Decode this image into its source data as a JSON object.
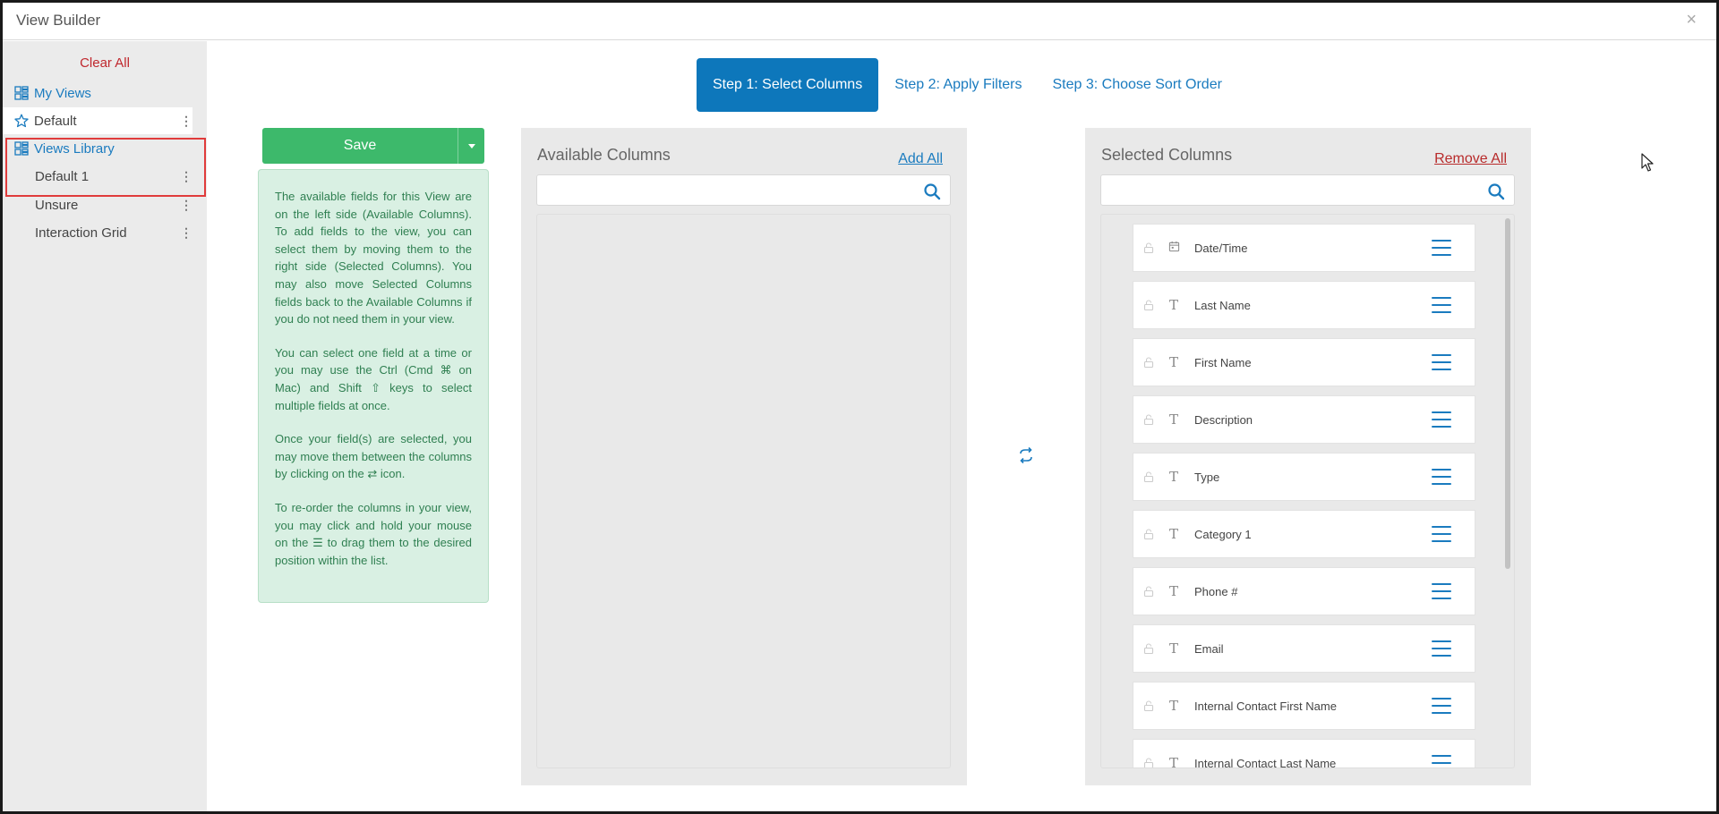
{
  "window": {
    "title": "View Builder",
    "close_glyph": "×"
  },
  "sidebar": {
    "clear_all": "Clear All",
    "my_views": {
      "label": "My Views",
      "icon": "views-grid-icon"
    },
    "default_view": {
      "label": "Default",
      "icon": "star-icon",
      "menu": "⋮"
    },
    "views_library": {
      "label": "Views Library",
      "icon": "views-grid-icon"
    },
    "library_items": [
      {
        "label": "Default 1",
        "menu": "⋮"
      },
      {
        "label": "Unsure",
        "menu": "⋮"
      },
      {
        "label": "Interaction Grid",
        "menu": "⋮"
      }
    ]
  },
  "steps": {
    "step1": "Step 1: Select Columns",
    "step2": "Step 2: Apply Filters",
    "step3": "Step 3: Choose Sort Order"
  },
  "save": {
    "label": "Save"
  },
  "help": {
    "p1": "The available fields for this View are on the left side (Available Columns). To add fields to the view, you can select them by moving them to the right side (Selected Columns). You may also move Selected Columns fields back to the Available Columns if you do not need them in your view.",
    "p2": "You can select one field at a time or you may use the Ctrl (Cmd ⌘ on Mac) and Shift ⇧ keys to select multiple fields at once.",
    "p3_before": "Once your field(s) are selected, you may move them between the columns by clicking on the ",
    "p3_icon": "⇄",
    "p3_after": " icon.",
    "p4_before": "To re-order the columns in your view, you may click and hold your mouse on the ",
    "p4_icon": "☰",
    "p4_after": " to drag them to the desired position within the list."
  },
  "available": {
    "title": "Available Columns",
    "action": "Add All",
    "search_placeholder": ""
  },
  "selected": {
    "title": "Selected Columns",
    "action": "Remove All",
    "search_placeholder": "",
    "columns": [
      {
        "name": "Date/Time",
        "type": "calendar"
      },
      {
        "name": "Last Name",
        "type": "T"
      },
      {
        "name": "First Name",
        "type": "T"
      },
      {
        "name": "Description",
        "type": "T"
      },
      {
        "name": "Type",
        "type": "T"
      },
      {
        "name": "Category 1",
        "type": "T"
      },
      {
        "name": "Phone #",
        "type": "T"
      },
      {
        "name": "Email",
        "type": "T"
      },
      {
        "name": "Internal Contact First Name",
        "type": "T"
      },
      {
        "name": "Internal Contact Last Name",
        "type": "T"
      }
    ]
  },
  "colors": {
    "accent": "#0d77bb",
    "save": "#3db96b",
    "danger": "#c0272d",
    "help_bg": "#d9f0e3"
  }
}
